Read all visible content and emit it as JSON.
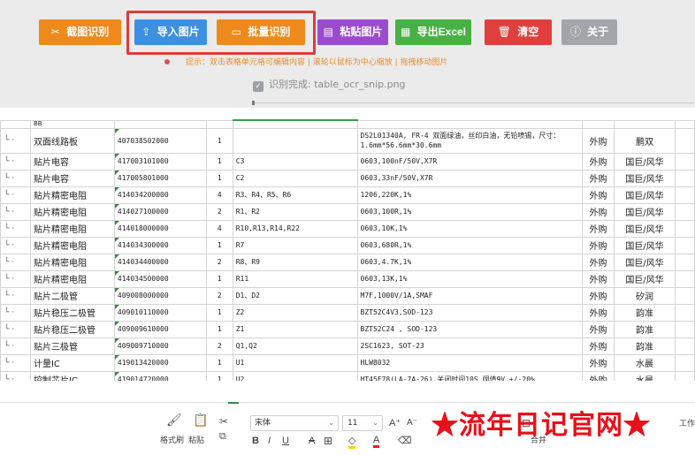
{
  "toolbar": {
    "snip": {
      "icon": "scissors-icon",
      "label": "截图识别"
    },
    "import": {
      "icon": "upload-icon",
      "label": "导入图片"
    },
    "batch": {
      "icon": "batch-icon",
      "label": "批量识别"
    },
    "paste": {
      "icon": "paste-icon",
      "label": "粘贴图片"
    },
    "excel": {
      "icon": "excel-icon",
      "label": "导出Excel"
    },
    "clear": {
      "icon": "trash-icon",
      "label": "清空"
    },
    "about": {
      "icon": "info-icon",
      "label": "关于"
    }
  },
  "hint": "提示：双击表格单元格可编辑内容 | 滚轮以鼠标为中心缩放 | 拖拽移动图片",
  "status": "识别完成: table_ocr_snip.png",
  "table": {
    "header_partial": "BB",
    "rows": [
      {
        "tree": "└ ·",
        "name": "双面线路板",
        "code": "407038502000",
        "qty": "1",
        "ref": "",
        "spec": "DS2L01340A, FR-4 双面绿油，丝印白油，无铅喷锡，尺寸：1.6mm*56.6mm*30.6mm",
        "src": "外购",
        "brand": "鹏双"
      },
      {
        "tree": "└ ·",
        "name": "贴片电容",
        "code": "417003101000",
        "qty": "1",
        "ref": "C3",
        "spec": "0603,100nF/50V,X7R",
        "src": "外购",
        "brand": "国巨/风华"
      },
      {
        "tree": "└ ·",
        "name": "贴片电容",
        "code": "417005801000",
        "qty": "1",
        "ref": "C2",
        "spec": "0603,33nF/50V,X7R",
        "src": "外购",
        "brand": "国巨/风华"
      },
      {
        "tree": "└ ·",
        "name": "贴片精密电阻",
        "code": "414034200000",
        "qty": "4",
        "ref": "R3、R4、R5、R6",
        "spec": "1206,220K,1%",
        "src": "外购",
        "brand": "国巨/风华"
      },
      {
        "tree": "└ ·",
        "name": "贴片精密电阻",
        "code": "414027100000",
        "qty": "2",
        "ref": "R1、R2",
        "spec": "0603,100R,1%",
        "src": "外购",
        "brand": "国巨/风华"
      },
      {
        "tree": "└ ·",
        "name": "贴片精密电阻",
        "code": "414018000000",
        "qty": "4",
        "ref": "R10,R13,R14,R22",
        "spec": "0603,10K,1%",
        "src": "外购",
        "brand": "国巨/风华"
      },
      {
        "tree": "└ ·",
        "name": "贴片精密电阻",
        "code": "414034300000",
        "qty": "1",
        "ref": "R7",
        "spec": "0603,680R,1%",
        "src": "外购",
        "brand": "国巨/风华"
      },
      {
        "tree": "└ ·",
        "name": "贴片精密电阻",
        "code": "414034400000",
        "qty": "2",
        "ref": "R8、R9",
        "spec": "0603,4.7K,1%",
        "src": "外购",
        "brand": "国巨/风华"
      },
      {
        "tree": "└ ·",
        "name": "贴片精密电阻",
        "code": "414034500000",
        "qty": "1",
        "ref": "R11",
        "spec": "0603,13K,1%",
        "src": "外购",
        "brand": "国巨/风华"
      },
      {
        "tree": "└ ·",
        "name": "贴片二极管",
        "code": "409008000000",
        "qty": "2",
        "ref": "D1、D2",
        "spec": "M7F,1000V/1A,SMAF",
        "src": "外购",
        "brand": "矽润"
      },
      {
        "tree": "└ ·",
        "name": "贴片稳压二极管",
        "code": "409010110000",
        "qty": "1",
        "ref": "Z2",
        "spec": "BZT52C4V3,SOD-123",
        "src": "外购",
        "brand": "韵准"
      },
      {
        "tree": "└ ·",
        "name": "贴片稳压二极管",
        "code": "409009610000",
        "qty": "1",
        "ref": "Z1",
        "spec": "BZT52C24 , SOD-123",
        "src": "外购",
        "brand": "韵准"
      },
      {
        "tree": "└ ·",
        "name": "贴片三极管",
        "code": "409009710000",
        "qty": "2",
        "ref": "Q1,Q2",
        "spec": "2SC1623, SOT-23",
        "src": "外购",
        "brand": "韵准"
      },
      {
        "tree": "└ ·",
        "name": "计量IC",
        "code": "419013420000",
        "qty": "1",
        "ref": "U1",
        "spec": "HLW8032",
        "src": "外购",
        "brand": "水晨"
      },
      {
        "tree": "└ ·",
        "name": "控制芯片IC",
        "code": "419014720000",
        "qty": "1",
        "ref": "U2",
        "spec": "HT45F78(LA-7A-26),关闭时间10S,阈值9V,+/-20%",
        "src": "外购",
        "brand": "水晨"
      }
    ]
  },
  "ribbon": {
    "format_painter": "格式刷",
    "paste": "粘贴",
    "font": "宋体",
    "size": "11",
    "merge": "合并",
    "work": "工作",
    "watermark": "★流年日记官网★"
  }
}
